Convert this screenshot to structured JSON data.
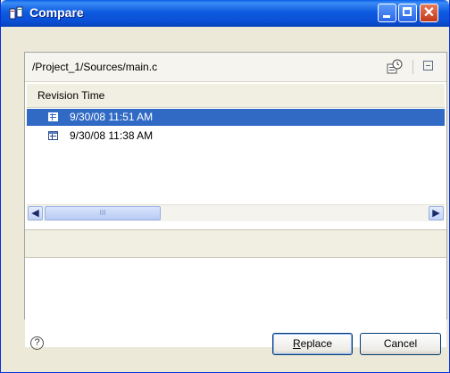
{
  "window": {
    "title": "Compare",
    "minimize_icon": "minimize-icon",
    "maximize_icon": "maximize-icon",
    "close_icon": "close-icon"
  },
  "path_bar": {
    "path": "/Project_1/Sources/main.c",
    "history_icon": "history-icon",
    "collapse_icon": "collapse-all-icon"
  },
  "table": {
    "column_header": "Revision Time",
    "rows": [
      {
        "label": "9/30/08 11:51 AM",
        "selected": true
      },
      {
        "label": "9/30/08 11:38 AM",
        "selected": false
      }
    ],
    "scroll_thumb_grip": "III"
  },
  "footer": {
    "help_symbol": "?",
    "replace_label_mnemonic": "R",
    "replace_label_rest": "eplace",
    "cancel_label": "Cancel"
  },
  "colors": {
    "titlebar": "#0a5ee8",
    "selection": "#316ac5",
    "dialog_bg": "#ece9d8"
  }
}
